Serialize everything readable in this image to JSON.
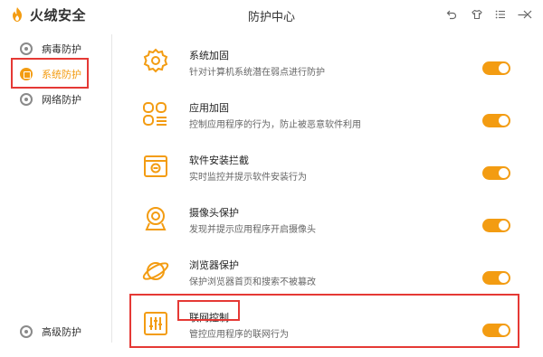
{
  "app": {
    "brand": "火绒安全",
    "window_title": "防护中心",
    "controls": [
      "back",
      "skin",
      "menu",
      "minimize",
      "close"
    ]
  },
  "sidebar": {
    "items": [
      {
        "label": "病毒防护",
        "icon": "shield-icon",
        "active": false
      },
      {
        "label": "系统防护",
        "icon": "windows-icon",
        "active": true
      },
      {
        "label": "网络防护",
        "icon": "globe-icon",
        "active": false
      }
    ],
    "bottom_item": {
      "label": "高级防护",
      "icon": "advanced-icon"
    }
  },
  "items": [
    {
      "title": "系统加固",
      "desc": "针对计算机系统潜在弱点进行防护",
      "icon": "gear-shield-icon",
      "enabled": true
    },
    {
      "title": "应用加固",
      "desc": "控制应用程序的行为，防止被恶意软件利用",
      "icon": "apps-icon",
      "enabled": true
    },
    {
      "title": "软件安装拦截",
      "desc": "实时监控并提示软件安装行为",
      "icon": "install-block-icon",
      "enabled": true
    },
    {
      "title": "摄像头保护",
      "desc": "发现并提示应用程序开启摄像头",
      "icon": "camera-icon",
      "enabled": true
    },
    {
      "title": "浏览器保护",
      "desc": "保护浏览器首页和搜索不被篡改",
      "icon": "browser-planet-icon",
      "enabled": true
    },
    {
      "title": "联网控制",
      "desc": "管控应用程序的联网行为",
      "icon": "network-sliders-icon",
      "enabled": true
    }
  ],
  "colors": {
    "accent": "#f39c12",
    "highlight": "#e53935"
  }
}
